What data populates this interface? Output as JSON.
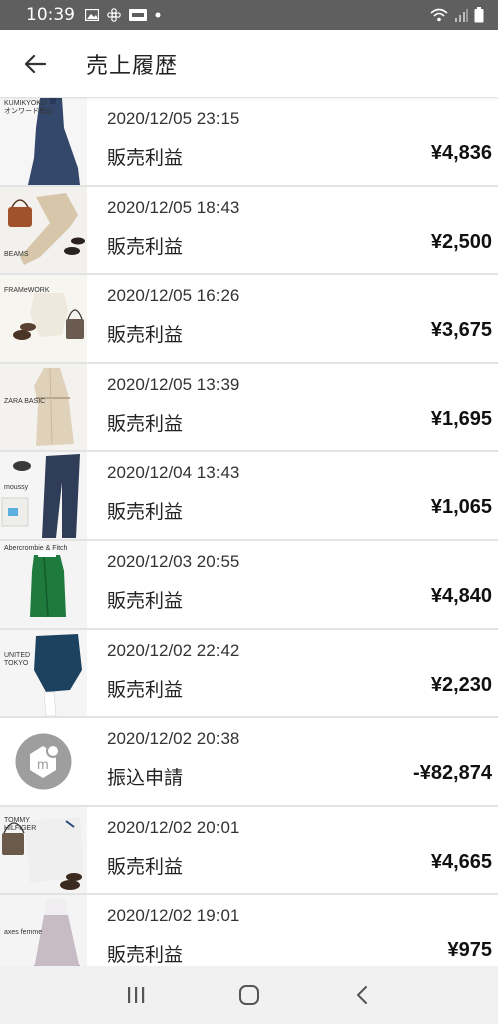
{
  "status_bar": {
    "time": "10:39",
    "left_icons": [
      "image-icon",
      "pinwheel-icon",
      "app-badge-icon",
      "dot-icon"
    ],
    "right_icons": [
      "wifi-icon",
      "signal-icon",
      "battery-icon"
    ]
  },
  "header": {
    "title": "売上履歴",
    "back_icon": "arrow-left-icon"
  },
  "colors": {
    "status_bar": "#5f5f5f",
    "divider": "#e3e3e3",
    "nav_bar": "#f1f1f1"
  },
  "rows": [
    {
      "thumb_label": "KUMIKYOKU\nオンワード樫山",
      "date": "2020/12/05 23:15",
      "type": "販売利益",
      "amount": "¥4,836"
    },
    {
      "thumb_label": "BEAMS",
      "date": "2020/12/05 18:43",
      "type": "販売利益",
      "amount": "¥2,500"
    },
    {
      "thumb_label": "FRAMeWORK",
      "date": "2020/12/05 16:26",
      "type": "販売利益",
      "amount": "¥3,675"
    },
    {
      "thumb_label": "ZARA BASIC",
      "date": "2020/12/05 13:39",
      "type": "販売利益",
      "amount": "¥1,695"
    },
    {
      "thumb_label": "moussy",
      "date": "2020/12/04 13:43",
      "type": "販売利益",
      "amount": "¥1,065"
    },
    {
      "thumb_label": "Abercrombie & Fitch",
      "date": "2020/12/03 20:55",
      "type": "販売利益",
      "amount": "¥4,840"
    },
    {
      "thumb_label": "UNITED TOKYO",
      "date": "2020/12/02 22:42",
      "type": "販売利益",
      "amount": "¥2,230"
    },
    {
      "thumb_label": "",
      "date": "2020/12/02 20:38",
      "type": "振込申請",
      "amount": "-¥82,874"
    },
    {
      "thumb_label": "TOMMY HILFIGER",
      "date": "2020/12/02 20:01",
      "type": "販売利益",
      "amount": "¥4,665"
    },
    {
      "thumb_label": "axes femme",
      "date": "2020/12/02 19:01",
      "type": "販売利益",
      "amount": "¥975"
    }
  ],
  "nav_bar": {
    "recents_icon": "recents-icon",
    "home_icon": "home-icon",
    "back_icon": "back-chevron-icon"
  }
}
